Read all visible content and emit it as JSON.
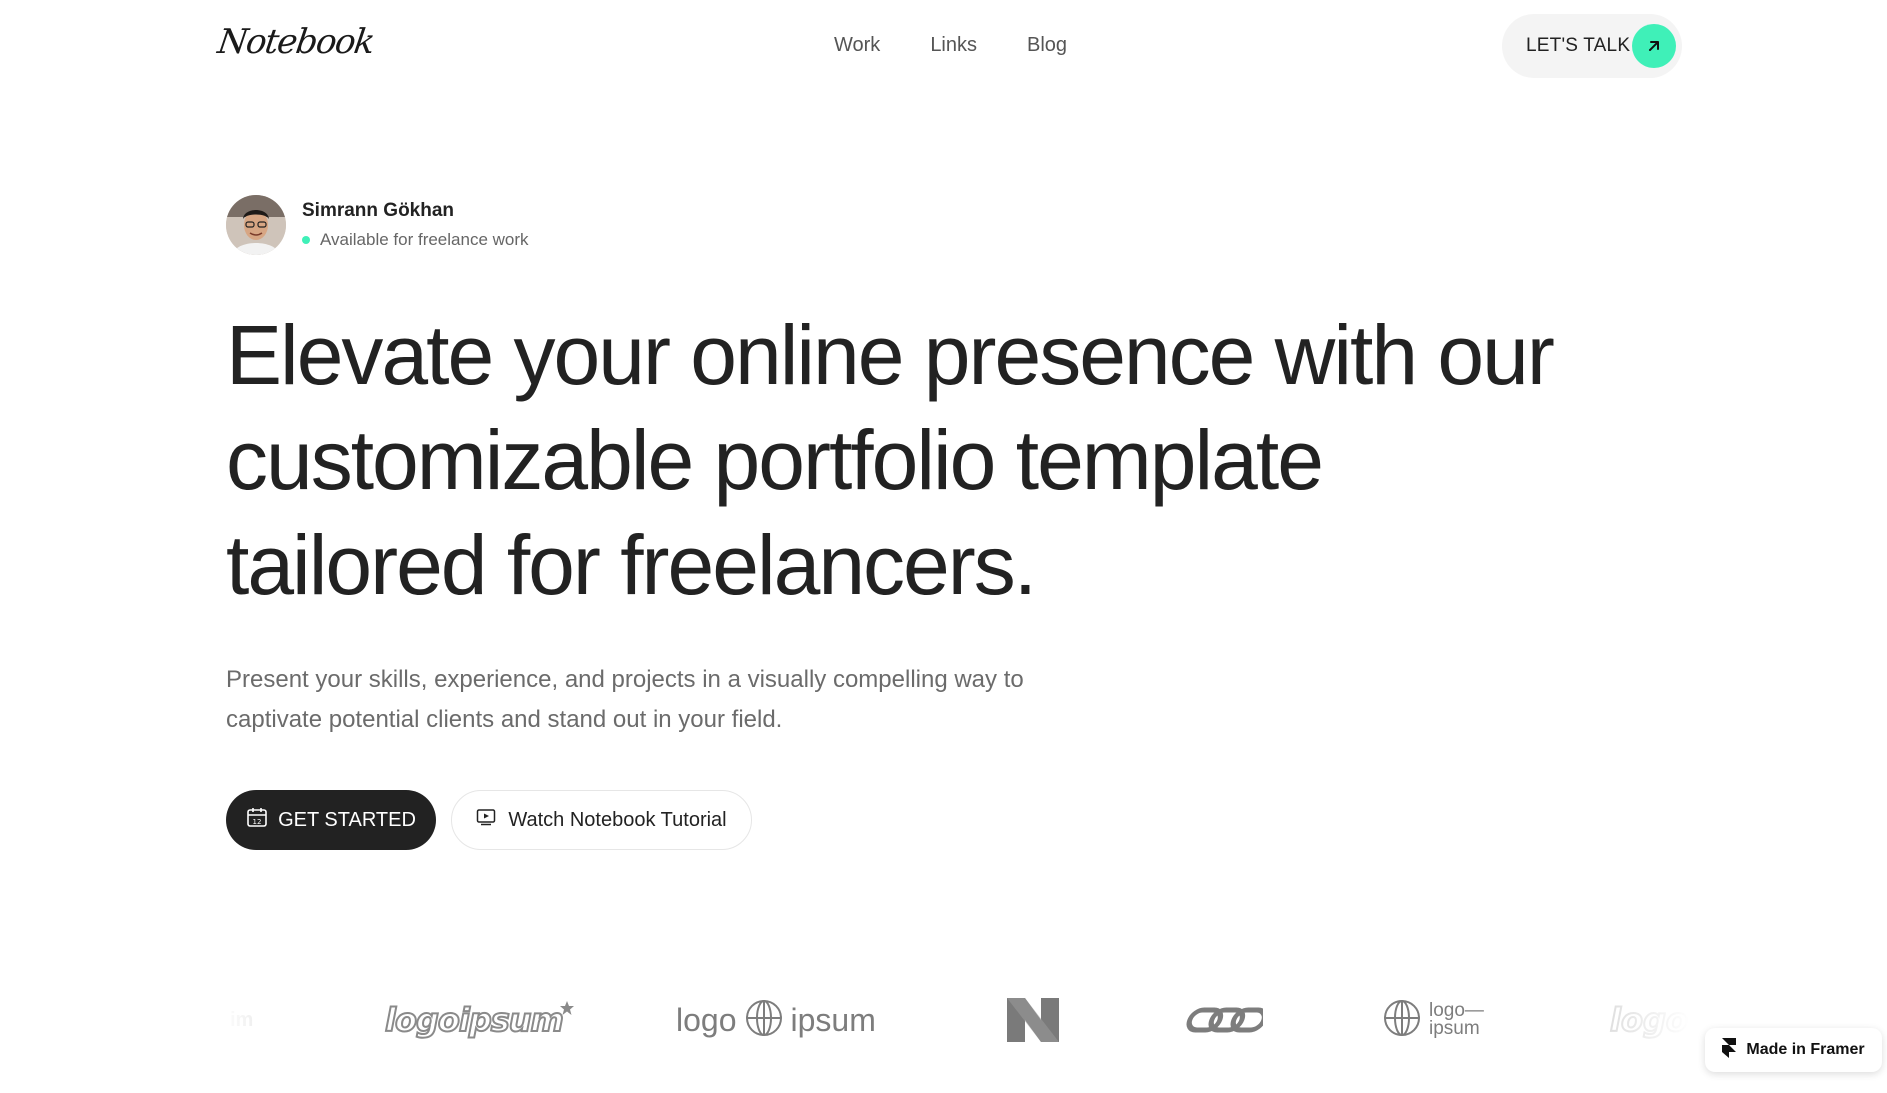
{
  "header": {
    "logo_text": "Notebook",
    "nav": [
      "Work",
      "Links",
      "Blog"
    ],
    "cta_label": "LET'S TALK",
    "cta_icon": "arrow-up-right-icon",
    "accent_color": "#3ff0b8"
  },
  "profile": {
    "name": "Simrann Gökhan",
    "status": "Available for freelance work",
    "status_color": "#3ff0b8"
  },
  "hero": {
    "headline_lines": [
      "Elevate your online presence with our",
      "customizable portfolio template",
      "tailored for freelancers."
    ],
    "subtext": "Present your skills, experience, and projects in a visually compelling way to captivate potential clients and stand out in your field.",
    "primary_button": "GET STARTED",
    "primary_icon": "calendar-icon",
    "secondary_button": "Watch Notebook Tutorial",
    "secondary_icon": "video-icon"
  },
  "logos": {
    "logoipsum_1": "logoipsum",
    "logo_ipsum_a": "logo",
    "logo_ipsum_b": "ipsum",
    "n_mark": "N",
    "logo_stack_a": "logo—",
    "logo_stack_b": "ipsum",
    "partial_left": "im",
    "partial_right": "logo"
  },
  "badge": {
    "label": "Made in Framer",
    "icon": "framer-icon"
  }
}
